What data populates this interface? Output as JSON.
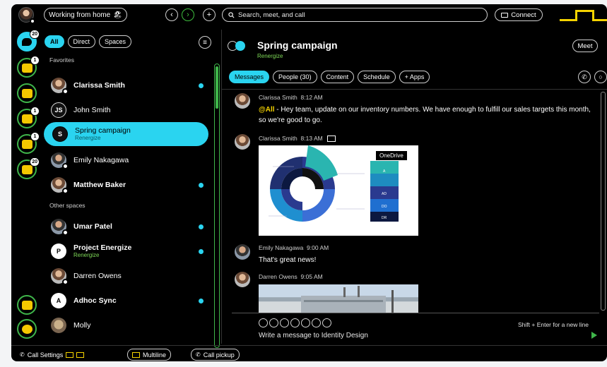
{
  "top_bar": {
    "status": "Working from home",
    "status_emoji": "🏖",
    "back_icon": "‹",
    "forward_icon": "›",
    "add_icon": "+",
    "search_placeholder": "Search, meet, and call",
    "connect_label": "Connect"
  },
  "rail": {
    "messaging_badge": "20",
    "teams_badge": "1",
    "calling_badge": "1",
    "meetings_badge": "1",
    "calendar_badge": "20"
  },
  "chat_list": {
    "filters": [
      "All",
      "Direct",
      "Spaces"
    ],
    "favorites_header": "Favorites",
    "other_header": "Other spaces",
    "favorites": [
      {
        "name": "Clarissa Smith",
        "bold": true,
        "unread": true,
        "avatar": "photo"
      },
      {
        "name": "John Smith",
        "bold": false,
        "unread": false,
        "avatar": "initials",
        "initials": "JS"
      },
      {
        "name": "Spring campaign",
        "sub": "Renergize",
        "bold": false,
        "selected": true,
        "avatar": "initials",
        "initials": "S"
      },
      {
        "name": "Emily Nakagawa",
        "bold": false,
        "unread": false,
        "avatar": "photo"
      },
      {
        "name": "Matthew Baker",
        "bold": true,
        "unread": true,
        "avatar": "photo"
      }
    ],
    "others": [
      {
        "name": "Umar Patel",
        "bold": true,
        "unread": true,
        "avatar": "photo"
      },
      {
        "name": "Project Energize",
        "sub": "Renergize",
        "bold": true,
        "unread": true,
        "avatar": "initials",
        "initials": "P"
      },
      {
        "name": "Darren Owens",
        "bold": false,
        "unread": false,
        "avatar": "photo"
      },
      {
        "name": "Adhoc Sync",
        "bold": true,
        "unread": true,
        "avatar": "initials",
        "initials": "A"
      },
      {
        "name": "Molly",
        "bold": false,
        "unread": false,
        "avatar": "dog"
      }
    ]
  },
  "space": {
    "title": "Spring campaign",
    "subtitle": "Renergize",
    "meet_label": "Meet",
    "tabs": [
      "Messages",
      "People (30)",
      "Content",
      "Schedule",
      "+ Apps"
    ]
  },
  "messages": [
    {
      "sender": "Clarissa Smith",
      "time": "8:12 AM",
      "mention": "@All",
      "text": " - Hey team, update on our inventory numbers. We have enough to fulfill our sales targets this month, so we're good to go."
    },
    {
      "sender": "Clarissa Smith",
      "time": "8:13 AM",
      "attachment_label": "OneDrive",
      "chart_levels": [
        "A",
        "AD",
        "DO",
        "DR"
      ]
    },
    {
      "sender": "Emily Nakagawa",
      "time": "9:00 AM",
      "text": "That's great news!"
    },
    {
      "sender": "Darren Owens",
      "time": "9:05 AM"
    }
  ],
  "composer": {
    "placeholder": "Write a message to Identity Design",
    "hint": "Shift + Enter for a new line"
  },
  "bottom_bar": {
    "call_settings": "Call Settings",
    "multiline": "Multiline",
    "call_pickup": "Call pickup"
  },
  "colors": {
    "accent": "#2ad4f0",
    "rail_ring": "#3fb54a",
    "rail_icon": "#f5c800",
    "space_sub": "#7ed957",
    "mention": "#f5d300"
  }
}
